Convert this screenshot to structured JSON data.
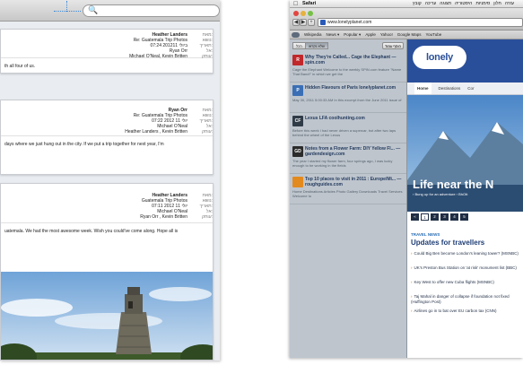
{
  "mail": {
    "messages": [
      {
        "from": "Heather Landers",
        "subject": "Re: Guatemala Trip Photos",
        "date": "07:24 2012ביולי 11",
        "to": "Ryan Orr",
        "cc": "Michael O'Neal, Kevin Britten",
        "labels": [
          "מאת:",
          "נושא:",
          "תאריך:",
          "אל:",
          "עותק:"
        ],
        "body": "th all four of us."
      },
      {
        "from": "Ryan Orr",
        "subject": "Re: Guatemala Trip Photos",
        "date": "07:22 2012 יולי 11",
        "to": "Michael O'Neal",
        "cc": "Heather Landers , Kevin Britten",
        "labels": [
          "מאת:",
          "נושא:",
          "תאריך:",
          "אל:",
          "עותק:"
        ],
        "body": "days where we just hung out in the city. If we put a trip together for next year, I'm"
      },
      {
        "from": "Heather Landers",
        "subject": "Guatemala Trip Photos",
        "date": "07:11 2012 יולי 11",
        "to": "Michael O'Neal",
        "cc": "Ryan Orr , Kevin Britten",
        "labels": [
          "מאת:",
          "נושא:",
          "תאריך:",
          "אל:",
          "עותק:"
        ],
        "body": "uatemala. We had the most awesome week. Wish you could've come along. Hope all is"
      }
    ]
  },
  "safari": {
    "app_name": "Safari",
    "menus": [
      "עזרה",
      "חלון",
      "סימניות",
      "היסטוריה",
      "תצוגה",
      "עריכה",
      "קובץ"
    ],
    "menubar_right": "יום",
    "address": "www.lonelyplanet.com",
    "bookmarks": [
      "Wikipedia",
      "News ▾",
      "Popular ▾",
      "Apple",
      "Yahoo!",
      "Google Maps",
      "YouTube"
    ],
    "reading_list": {
      "tabs": [
        "הכל",
        "שלא נקראו"
      ],
      "add_label": "הוסף עמוד",
      "items": [
        {
          "thumb": "R",
          "thumb_color": "#c0282b",
          "title": "Why They're Called... Cage the Elephant — spin.com",
          "desc": "Cage the Elephant Welcome to the weekly SPIN.com feature \"Name That Band!\" in which we get the"
        },
        {
          "thumb": "P",
          "thumb_color": "#3a6fb5",
          "title": "Hidden Flavours of Paris lonelyplanet.com",
          "desc": "May 30, 2011 5:00:33 AM In this excerpt from the June 2011 issue of"
        },
        {
          "thumb": "CF",
          "thumb_color": "#2f3b47",
          "title": "Lexus LFA coolhunting.com",
          "desc": "Before this week I had never driven a supercar, but after two laps behind the wheel of the Lexus"
        },
        {
          "thumb": "GD",
          "thumb_color": "#2b2b2b",
          "title": "Notes from a Flower Farm: DIY Yellow Fl... — gardendesign.com",
          "desc": "The year I started my flower farm, four springs ago, I was lucky enough to be working in the fields"
        },
        {
          "thumb": "",
          "thumb_color": "#e38a1e",
          "title": "Top 10 places to visit in 2011 : Europe/Mi... — roughguides.com",
          "desc": "Home Destinations Articles Photo Gallery Downloads Travel Services Welcome to"
        }
      ]
    },
    "page": {
      "logo": "lonely planet",
      "nav": [
        "Home",
        "Destinations",
        "Cor"
      ],
      "hero_title": "Life near the N",
      "hero_links": "› Bung up for an adventure   › BhOtt",
      "pager": [
        "1",
        "2",
        "3",
        "4",
        "5"
      ],
      "pager_prev": "«",
      "news_label": "TRAVEL NEWS",
      "news_title": "Updates for travellers",
      "news_items": [
        "Could Big Ben become London's leaning tower? (MSNBC)",
        "UK's Preston Bus Station on 'at risk' monument list (BBC)",
        "Key West to offer new Cuba flights (MSNBC)",
        "Taj Mahal in danger of collapse if foundation not fixed (Huffington Post)",
        "Airlines go in to bat over EU carbon tax (CNN)"
      ]
    }
  }
}
